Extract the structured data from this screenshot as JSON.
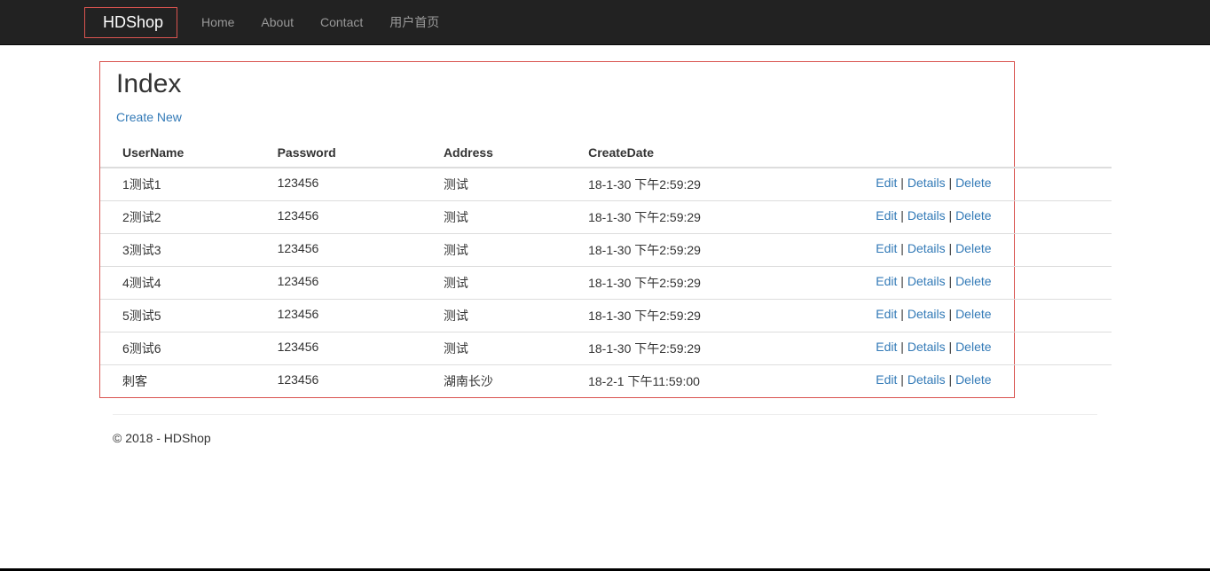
{
  "navbar": {
    "brand": "HDShop",
    "items": [
      "Home",
      "About",
      "Contact",
      "用户首页"
    ]
  },
  "page": {
    "title": "Index",
    "createNewLabel": "Create New"
  },
  "table": {
    "headers": {
      "username": "UserName",
      "password": "Password",
      "address": "Address",
      "createDate": "CreateDate"
    },
    "rows": [
      {
        "username": "1测试1",
        "password": "123456",
        "address": "测试",
        "createDate": "18-1-30 下午2:59:29"
      },
      {
        "username": "2测试2",
        "password": "123456",
        "address": "测试",
        "createDate": "18-1-30 下午2:59:29"
      },
      {
        "username": "3测试3",
        "password": "123456",
        "address": "测试",
        "createDate": "18-1-30 下午2:59:29"
      },
      {
        "username": "4测试4",
        "password": "123456",
        "address": "测试",
        "createDate": "18-1-30 下午2:59:29"
      },
      {
        "username": "5测试5",
        "password": "123456",
        "address": "测试",
        "createDate": "18-1-30 下午2:59:29"
      },
      {
        "username": "6测试6",
        "password": "123456",
        "address": "测试",
        "createDate": "18-1-30 下午2:59:29"
      },
      {
        "username": "刺客",
        "password": "123456",
        "address": "湖南长沙",
        "createDate": "18-2-1 下午11:59:00"
      }
    ],
    "actions": {
      "edit": "Edit",
      "details": "Details",
      "delete": "Delete"
    }
  },
  "footer": {
    "text": "© 2018 - HDShop"
  }
}
